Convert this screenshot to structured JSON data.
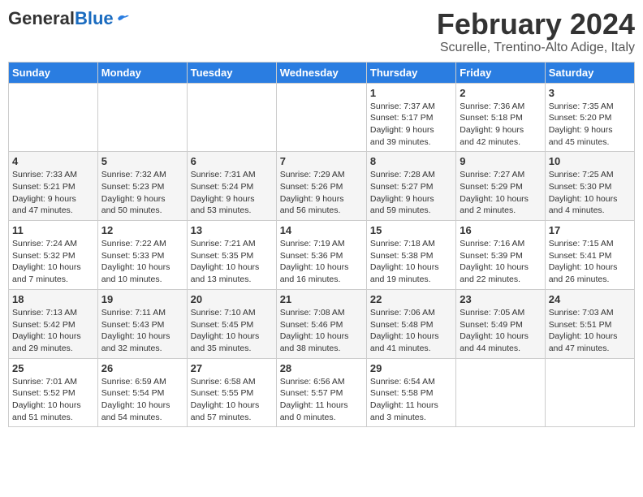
{
  "header": {
    "logo_general": "General",
    "logo_blue": "Blue",
    "month_title": "February 2024",
    "location": "Scurelle, Trentino-Alto Adige, Italy"
  },
  "calendar": {
    "days_of_week": [
      "Sunday",
      "Monday",
      "Tuesday",
      "Wednesday",
      "Thursday",
      "Friday",
      "Saturday"
    ],
    "weeks": [
      {
        "days": [
          {
            "num": "",
            "info": ""
          },
          {
            "num": "",
            "info": ""
          },
          {
            "num": "",
            "info": ""
          },
          {
            "num": "",
            "info": ""
          },
          {
            "num": "1",
            "info": "Sunrise: 7:37 AM\nSunset: 5:17 PM\nDaylight: 9 hours\nand 39 minutes."
          },
          {
            "num": "2",
            "info": "Sunrise: 7:36 AM\nSunset: 5:18 PM\nDaylight: 9 hours\nand 42 minutes."
          },
          {
            "num": "3",
            "info": "Sunrise: 7:35 AM\nSunset: 5:20 PM\nDaylight: 9 hours\nand 45 minutes."
          }
        ]
      },
      {
        "days": [
          {
            "num": "4",
            "info": "Sunrise: 7:33 AM\nSunset: 5:21 PM\nDaylight: 9 hours\nand 47 minutes."
          },
          {
            "num": "5",
            "info": "Sunrise: 7:32 AM\nSunset: 5:23 PM\nDaylight: 9 hours\nand 50 minutes."
          },
          {
            "num": "6",
            "info": "Sunrise: 7:31 AM\nSunset: 5:24 PM\nDaylight: 9 hours\nand 53 minutes."
          },
          {
            "num": "7",
            "info": "Sunrise: 7:29 AM\nSunset: 5:26 PM\nDaylight: 9 hours\nand 56 minutes."
          },
          {
            "num": "8",
            "info": "Sunrise: 7:28 AM\nSunset: 5:27 PM\nDaylight: 9 hours\nand 59 minutes."
          },
          {
            "num": "9",
            "info": "Sunrise: 7:27 AM\nSunset: 5:29 PM\nDaylight: 10 hours\nand 2 minutes."
          },
          {
            "num": "10",
            "info": "Sunrise: 7:25 AM\nSunset: 5:30 PM\nDaylight: 10 hours\nand 4 minutes."
          }
        ]
      },
      {
        "days": [
          {
            "num": "11",
            "info": "Sunrise: 7:24 AM\nSunset: 5:32 PM\nDaylight: 10 hours\nand 7 minutes."
          },
          {
            "num": "12",
            "info": "Sunrise: 7:22 AM\nSunset: 5:33 PM\nDaylight: 10 hours\nand 10 minutes."
          },
          {
            "num": "13",
            "info": "Sunrise: 7:21 AM\nSunset: 5:35 PM\nDaylight: 10 hours\nand 13 minutes."
          },
          {
            "num": "14",
            "info": "Sunrise: 7:19 AM\nSunset: 5:36 PM\nDaylight: 10 hours\nand 16 minutes."
          },
          {
            "num": "15",
            "info": "Sunrise: 7:18 AM\nSunset: 5:38 PM\nDaylight: 10 hours\nand 19 minutes."
          },
          {
            "num": "16",
            "info": "Sunrise: 7:16 AM\nSunset: 5:39 PM\nDaylight: 10 hours\nand 22 minutes."
          },
          {
            "num": "17",
            "info": "Sunrise: 7:15 AM\nSunset: 5:41 PM\nDaylight: 10 hours\nand 26 minutes."
          }
        ]
      },
      {
        "days": [
          {
            "num": "18",
            "info": "Sunrise: 7:13 AM\nSunset: 5:42 PM\nDaylight: 10 hours\nand 29 minutes."
          },
          {
            "num": "19",
            "info": "Sunrise: 7:11 AM\nSunset: 5:43 PM\nDaylight: 10 hours\nand 32 minutes."
          },
          {
            "num": "20",
            "info": "Sunrise: 7:10 AM\nSunset: 5:45 PM\nDaylight: 10 hours\nand 35 minutes."
          },
          {
            "num": "21",
            "info": "Sunrise: 7:08 AM\nSunset: 5:46 PM\nDaylight: 10 hours\nand 38 minutes."
          },
          {
            "num": "22",
            "info": "Sunrise: 7:06 AM\nSunset: 5:48 PM\nDaylight: 10 hours\nand 41 minutes."
          },
          {
            "num": "23",
            "info": "Sunrise: 7:05 AM\nSunset: 5:49 PM\nDaylight: 10 hours\nand 44 minutes."
          },
          {
            "num": "24",
            "info": "Sunrise: 7:03 AM\nSunset: 5:51 PM\nDaylight: 10 hours\nand 47 minutes."
          }
        ]
      },
      {
        "days": [
          {
            "num": "25",
            "info": "Sunrise: 7:01 AM\nSunset: 5:52 PM\nDaylight: 10 hours\nand 51 minutes."
          },
          {
            "num": "26",
            "info": "Sunrise: 6:59 AM\nSunset: 5:54 PM\nDaylight: 10 hours\nand 54 minutes."
          },
          {
            "num": "27",
            "info": "Sunrise: 6:58 AM\nSunset: 5:55 PM\nDaylight: 10 hours\nand 57 minutes."
          },
          {
            "num": "28",
            "info": "Sunrise: 6:56 AM\nSunset: 5:57 PM\nDaylight: 11 hours\nand 0 minutes."
          },
          {
            "num": "29",
            "info": "Sunrise: 6:54 AM\nSunset: 5:58 PM\nDaylight: 11 hours\nand 3 minutes."
          },
          {
            "num": "",
            "info": ""
          },
          {
            "num": "",
            "info": ""
          }
        ]
      }
    ]
  }
}
